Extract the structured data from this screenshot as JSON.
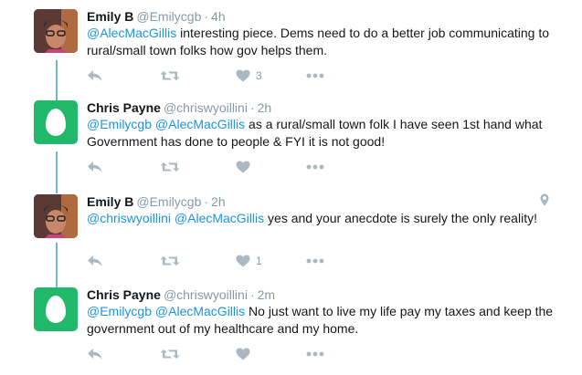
{
  "tweets": [
    {
      "name": "Emily B",
      "handle": "@Emilycgb",
      "time": "4h",
      "segments": [
        {
          "text": "@AlecMacGillis",
          "type": "mention"
        },
        {
          "text": " interesting piece. Dems need to do a better job communicating to rural/small town folks how gov helps them.",
          "type": "text"
        }
      ],
      "avatar": "photo",
      "like_count": "3"
    },
    {
      "name": "Chris Payne",
      "handle": "@chriswyoillini",
      "time": "2h",
      "segments": [
        {
          "text": "@Emilycgb",
          "type": "mention"
        },
        {
          "text": " ",
          "type": "text"
        },
        {
          "text": "@AlecMacGillis",
          "type": "mention"
        },
        {
          "text": " as a rural/small town folk I have seen 1st hand what Government has done to people & FYI it is not good!",
          "type": "text"
        }
      ],
      "avatar": "egg",
      "like_count": ""
    },
    {
      "name": "Emily B",
      "handle": "@Emilycgb",
      "time": "2h",
      "segments": [
        {
          "text": "@chriswyoillini",
          "type": "mention"
        },
        {
          "text": " ",
          "type": "text"
        },
        {
          "text": "@AlecMacGillis",
          "type": "mention"
        },
        {
          "text": " yes and your anecdote is surely the only reality!",
          "type": "text"
        }
      ],
      "avatar": "photo",
      "like_count": "1",
      "geo_icon": "location-pin-icon"
    },
    {
      "name": "Chris Payne",
      "handle": "@chriswyoillini",
      "time": "2m",
      "segments": [
        {
          "text": "@Emilycgb",
          "type": "mention"
        },
        {
          "text": " ",
          "type": "text"
        },
        {
          "text": "@AlecMacGillis",
          "type": "mention"
        },
        {
          "text": " No just want to live my life pay my taxes and keep the government out of my healthcare and my home.",
          "type": "text"
        }
      ],
      "avatar": "egg",
      "like_count": ""
    }
  ],
  "separator": "·",
  "icons": [
    "reply-icon",
    "retweet-icon",
    "like-icon",
    "more-icon"
  ],
  "colors": {
    "mention": "#1b95e0",
    "thread_line": "#6fb9c9",
    "egg_green": "#21b86a",
    "action_gray": "#aab8c2"
  }
}
